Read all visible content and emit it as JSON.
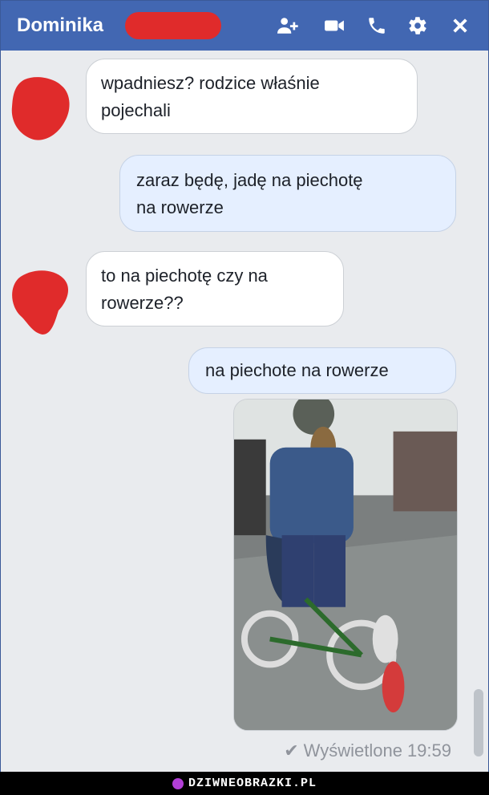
{
  "header": {
    "title": "Dominika",
    "icons": [
      "add-person-icon",
      "video-call-icon",
      "phone-icon",
      "gear-icon",
      "close-icon"
    ],
    "redaction_color": "#e02b2b"
  },
  "messages": [
    {
      "side": "incoming",
      "lines": [
        "wpadniesz? rodzice właśnie",
        "pojechali"
      ]
    },
    {
      "side": "outgoing",
      "lines": [
        "zaraz będę, jadę na piechotę",
        "na rowerze"
      ]
    },
    {
      "side": "incoming",
      "lines": [
        "to na piechotę czy na",
        "rowerze??"
      ]
    },
    {
      "side": "outgoing",
      "lines": [
        "na piechote na rowerze"
      ]
    }
  ],
  "status": {
    "label": "Wyświetlone",
    "time": "19:59",
    "check": "✔"
  },
  "footer": {
    "brand": "DZIWNEOBRAZKI.PL"
  },
  "colors": {
    "header": "#4267b2",
    "incoming_bubble": "#ffffff",
    "outgoing_bubble": "#e5efff",
    "background": "#e9ebee"
  }
}
